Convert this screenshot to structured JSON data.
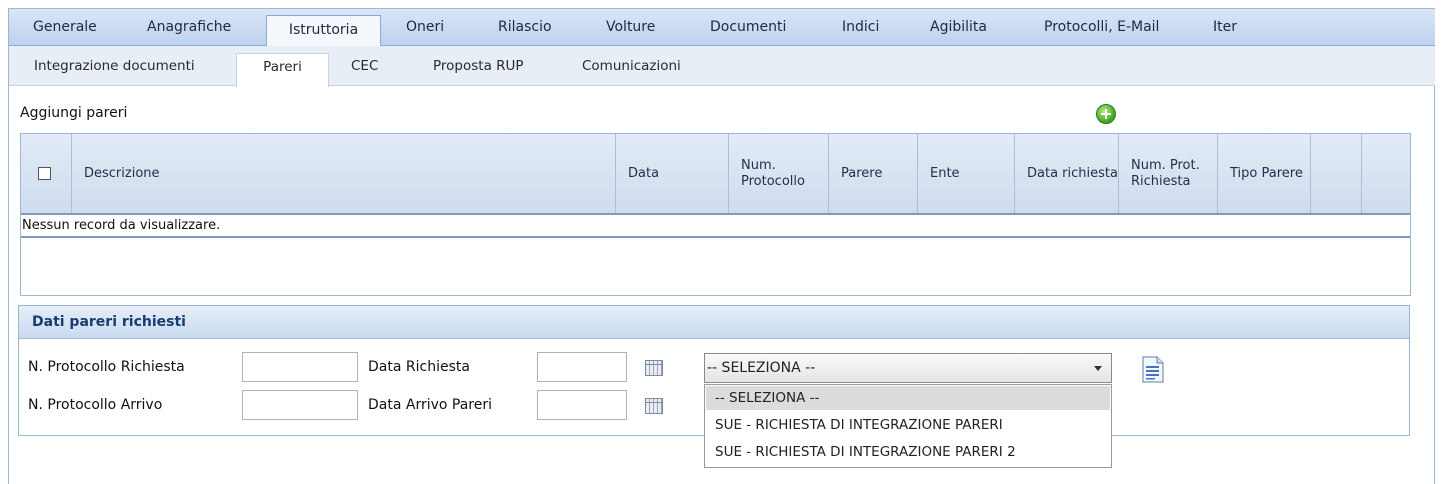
{
  "main_tabs": [
    "Generale",
    "Anagrafiche",
    "Istruttoria",
    "Oneri",
    "Rilascio",
    "Volture",
    "Documenti",
    "Indici",
    "Agibilita",
    "Protocolli, E-Mail",
    "Iter"
  ],
  "main_tab_active": "Istruttoria",
  "sub_tabs": [
    "Integrazione documenti",
    "Pareri",
    "CEC",
    "Proposta RUP",
    "Comunicazioni"
  ],
  "sub_tab_active": "Pareri",
  "add_section": {
    "title": "Aggiungi pareri",
    "add_icon": "plus-circle-icon"
  },
  "grid": {
    "headers": {
      "descrizione": "Descrizione",
      "data": "Data",
      "num_protocollo": "Num. Protocollo",
      "parere": "Parere",
      "ente": "Ente",
      "data_richiesta": "Data richiesta",
      "num_prot_richiesta": "Num. Prot. Richiesta",
      "tipo_parere": "Tipo Parere"
    },
    "empty_message": "Nessun record da visualizzare."
  },
  "details": {
    "title": "Dati pareri richiesti",
    "labels": {
      "n_protocollo_richiesta": "N. Protocollo Richiesta",
      "data_richiesta": "Data Richiesta",
      "n_protocollo_arrivo": "N. Protocollo Arrivo",
      "data_arrivo_pareri": "Data Arrivo Pareri"
    },
    "values": {
      "n_protocollo_richiesta": "",
      "data_richiesta": "",
      "n_protocollo_arrivo": "",
      "data_arrivo_pareri": ""
    },
    "select": {
      "selected": "-- SELEZIONA --",
      "options": [
        "-- SELEZIONA --",
        "SUE - RICHIESTA DI INTEGRAZIONE PARERI",
        "SUE - RICHIESTA DI INTEGRAZIONE PARERI 2"
      ]
    },
    "calendar_icon": "calendar-icon",
    "document_icon": "document-icon"
  }
}
